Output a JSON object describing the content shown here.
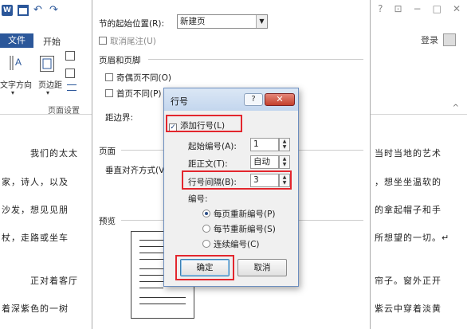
{
  "word": {
    "tabs": {
      "file": "文件",
      "home": "开始"
    },
    "login": "登录",
    "ribbon": {
      "text_direction": "文字方向",
      "margins": "页边距",
      "group_label": "页面设置"
    },
    "paragraphs": [
      {
        "left": "我们的太太",
        "right": "当时当地的艺术"
      },
      {
        "left": "家，诗人，以及",
        "right": "，想坐坐温软的"
      },
      {
        "left": "沙发，想见见朋",
        "right": "的拿起帽子和手"
      },
      {
        "left": "杖，走路或坐车",
        "right": "所想望的一切。↵"
      },
      {
        "left": "正对着客厅",
        "right": "帘子。窗外正开"
      },
      {
        "left": "着深紫色的一树",
        "right": "紫云中穿着淡黄"
      }
    ]
  },
  "page_setup": {
    "section_start_label": "节的起始位置(R):",
    "section_start_value": "新建页",
    "suppress_endnotes": "取消尾注(U)",
    "headers_footers": "页眉和页脚",
    "odd_even": "奇偶页不同(O)",
    "first_page": "首页不同(P)",
    "from_edge": "距边界:",
    "page_group": "页面",
    "vertical_align": "垂直对齐方式(V)",
    "preview": "预览"
  },
  "line_numbers": {
    "title": "行号",
    "help": "?",
    "close": "✕",
    "add_line_numbers": "添加行号(L)",
    "start_at_label": "起始编号(A):",
    "start_at_value": "1",
    "from_text_label": "距正文(T):",
    "from_text_value": "自动",
    "count_by_label": "行号间隔(B):",
    "count_by_value": "3",
    "numbering_label": "编号:",
    "options": [
      "每页重新编号(P)",
      "每节重新编号(S)",
      "连续编号(C)"
    ],
    "selected_option": 0,
    "ok": "确定",
    "cancel": "取消"
  },
  "colors": {
    "accent": "#2b579a",
    "highlight": "#e3262d"
  }
}
